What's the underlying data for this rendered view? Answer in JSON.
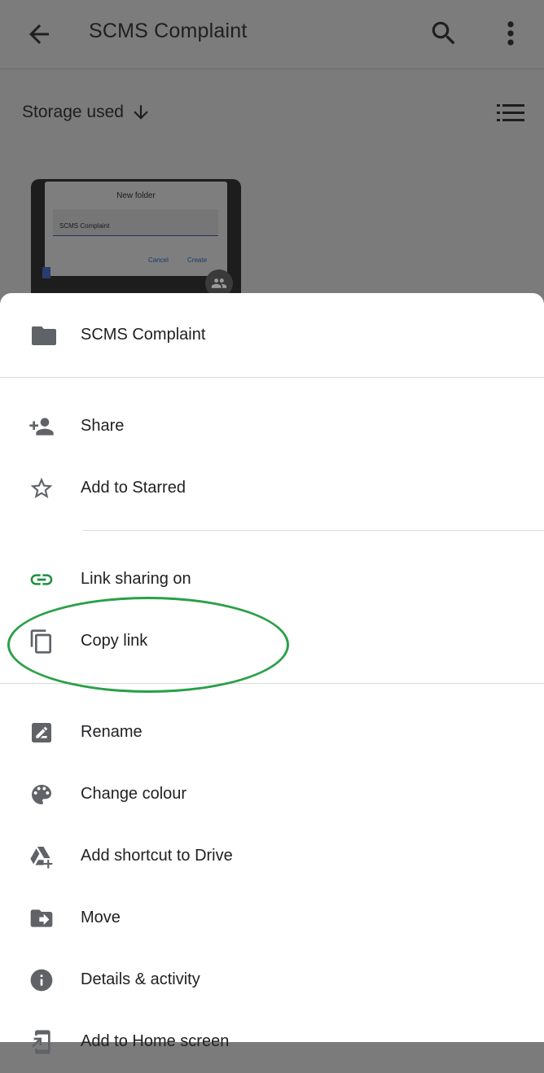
{
  "appbar": {
    "title": "SCMS Complaint",
    "back_icon": "arrow-back-icon",
    "search_icon": "search-icon",
    "more_icon": "more-vert-icon"
  },
  "sort": {
    "label": "Storage used",
    "arrow_icon": "arrow-down-icon",
    "view_icon": "list-view-icon"
  },
  "thumbnail": {
    "dialog_title": "New folder",
    "field_value": "SCMS Complaint",
    "cancel": "Cancel",
    "create": "Create"
  },
  "sheet": {
    "header": {
      "title": "SCMS Complaint",
      "icon": "folder-icon"
    },
    "items": [
      {
        "label": "Share",
        "icon": "person-add-icon"
      },
      {
        "label": "Add to Starred",
        "icon": "star-outline-icon"
      },
      {
        "label": "Link sharing on",
        "icon": "link-icon"
      },
      {
        "label": "Copy link",
        "icon": "copy-icon"
      },
      {
        "label": "Rename",
        "icon": "rename-icon"
      },
      {
        "label": "Change colour",
        "icon": "palette-icon"
      },
      {
        "label": "Add shortcut to Drive",
        "icon": "drive-add-icon"
      },
      {
        "label": "Move",
        "icon": "move-folder-icon"
      },
      {
        "label": "Details & activity",
        "icon": "info-icon"
      },
      {
        "label": "Add to Home screen",
        "icon": "add-to-home-icon"
      }
    ]
  },
  "colors": {
    "link_green": "#1e8e3e",
    "highlight_ring": "#2aa048",
    "icon_gray": "#5f6368"
  }
}
